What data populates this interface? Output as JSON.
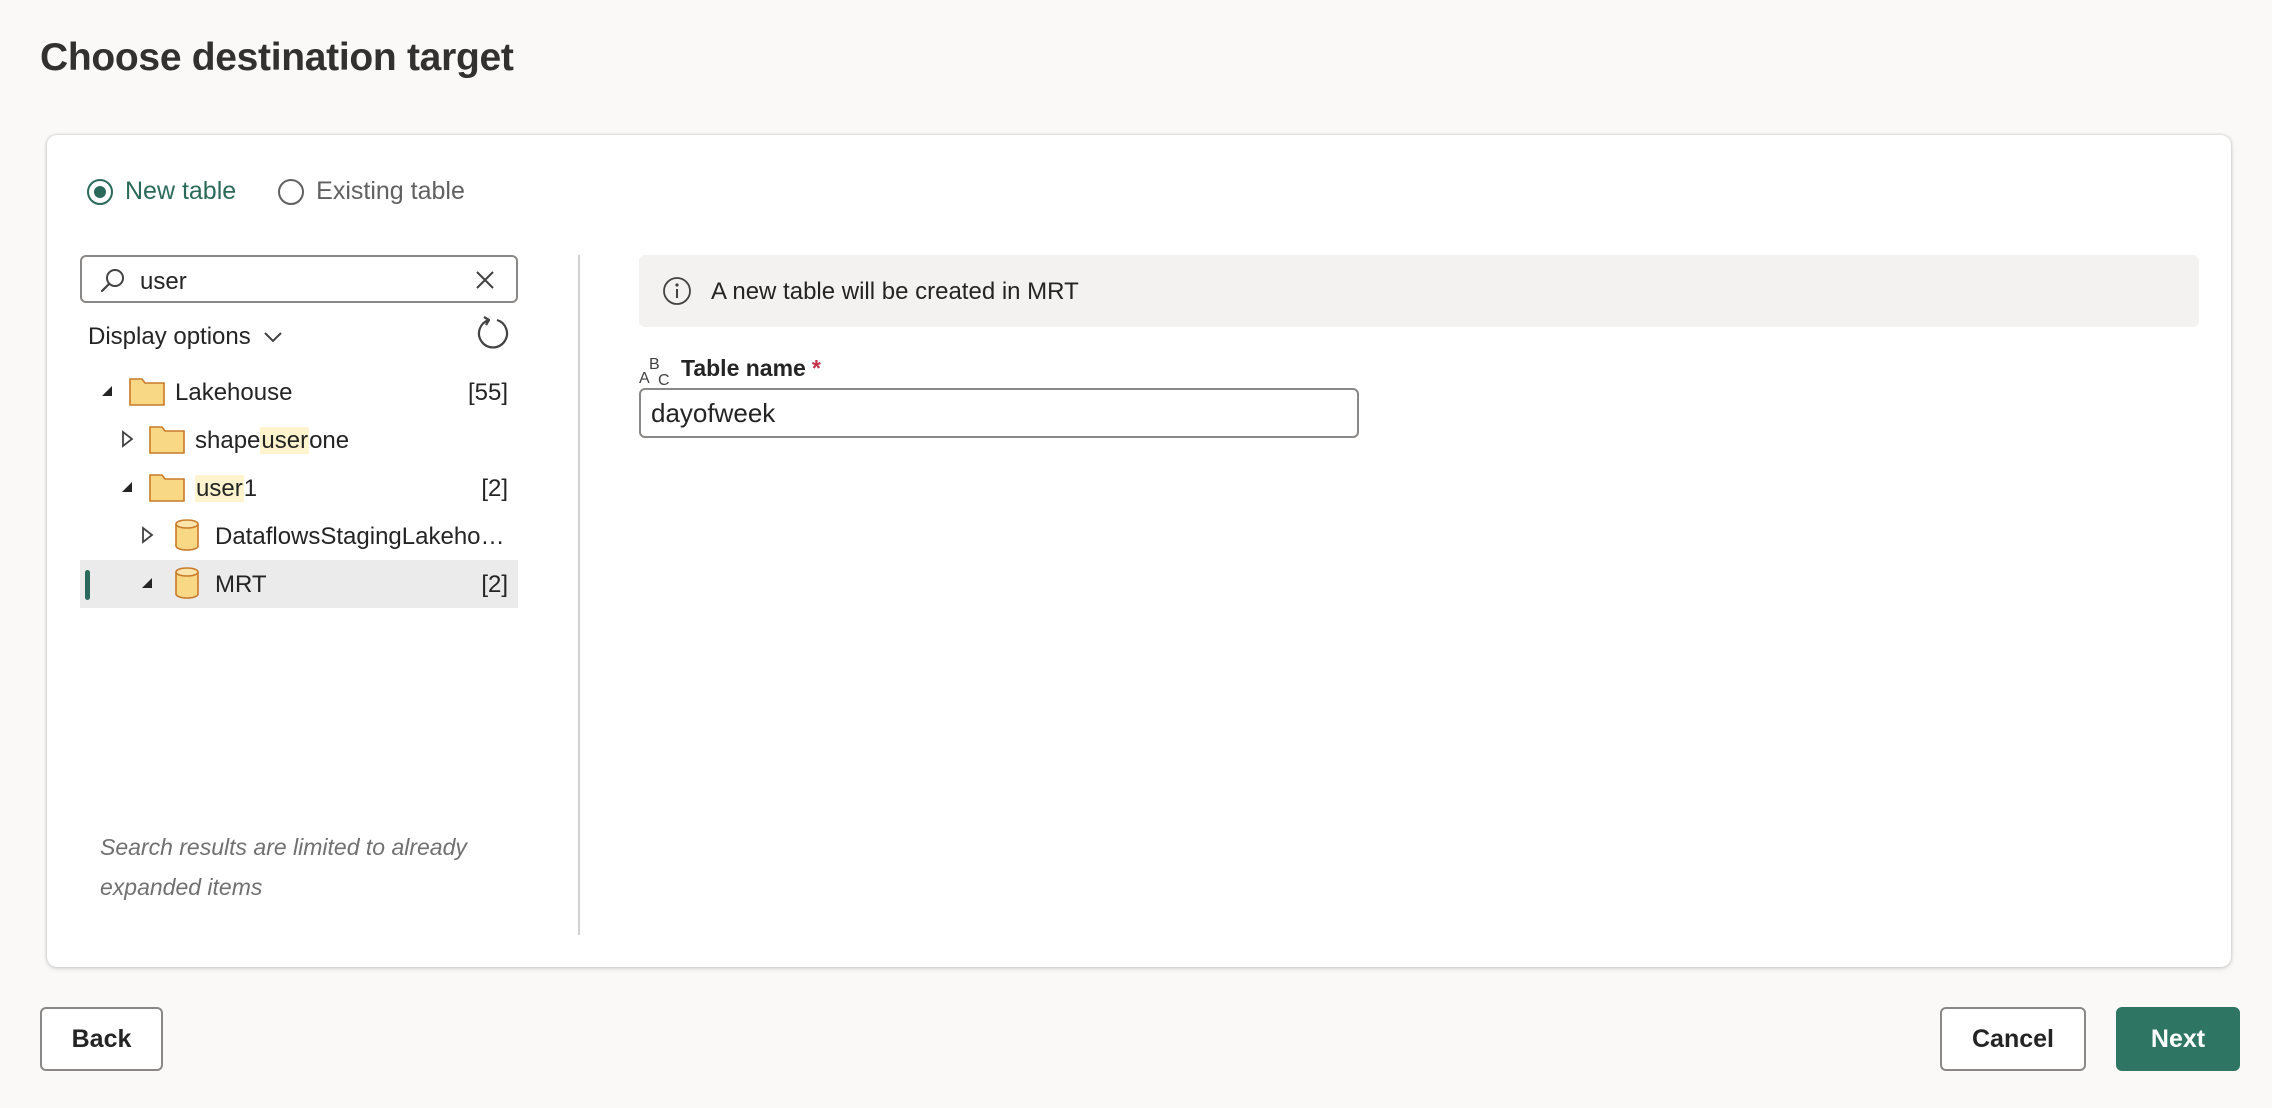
{
  "page": {
    "title": "Choose destination target"
  },
  "mode": {
    "new_table_label": "New table",
    "existing_table_label": "Existing table",
    "selected": "new_table"
  },
  "search": {
    "value": "user"
  },
  "display_options_label": "Display options",
  "tree": {
    "lakehouse": {
      "label": "Lakehouse",
      "count": "[55]"
    },
    "shapeuserone": {
      "label_pre": "shape",
      "label_match": "user",
      "label_post": "one"
    },
    "user1": {
      "label_match": "user",
      "label_post": "1",
      "count": "[2]"
    },
    "dataflows": {
      "label": "DataflowsStagingLakehou..."
    },
    "mrt": {
      "label": "MRT",
      "count": "[2]"
    }
  },
  "hint_text": "Search results are limited to already expanded items",
  "info": {
    "text": "A new table will be created in MRT"
  },
  "table_name": {
    "label": "Table name",
    "required_marker": "*",
    "value": "dayofweek"
  },
  "footer": {
    "back_label": "Back",
    "cancel_label": "Cancel",
    "next_label": "Next"
  },
  "colors": {
    "accent": "#2b6a5a",
    "primary_button": "#2f7563",
    "highlight": "#fff4ce",
    "folder_fill": "#f8d885",
    "folder_stroke": "#c97a2a",
    "required": "#c4314b"
  },
  "icons": {
    "search": "search-icon",
    "clear": "close-icon",
    "chevron": "chevron-down-icon",
    "refresh": "refresh-icon",
    "folder": "folder-icon",
    "lakehouse": "database-icon",
    "info": "info-icon",
    "text_type": "abc-text-icon"
  }
}
